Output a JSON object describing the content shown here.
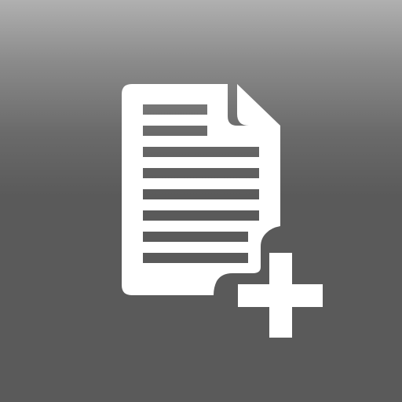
{
  "app_icon": {
    "name": "new-document-icon",
    "background_top": "#b0b0b0",
    "background_bottom": "#5a5a5a",
    "glyph_color": "#ffffff"
  }
}
